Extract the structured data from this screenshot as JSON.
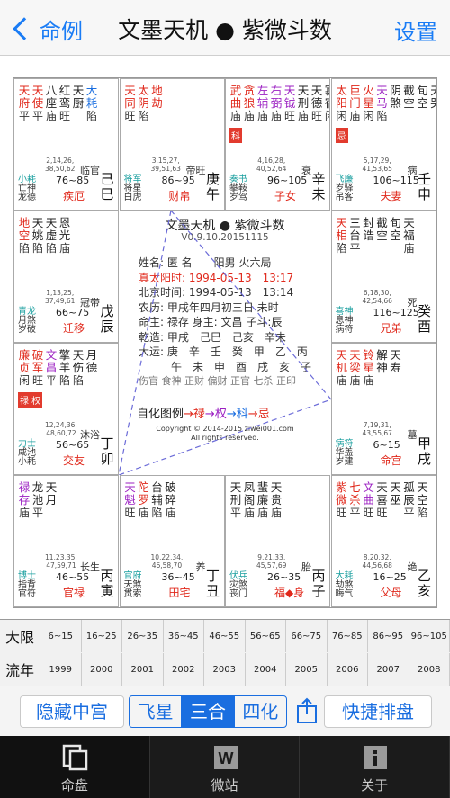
{
  "nav": {
    "back_label": "命例",
    "title": "文墨天机 ● 紫微斗数",
    "right_label": "设置"
  },
  "colors": {
    "accent": "#1a7cf5",
    "red": "#e0281b",
    "blue": "#1a6ee0",
    "purple": "#9b1fc2",
    "badge": "#e23b2e"
  },
  "cells": [
    {
      "id": "si",
      "stars": [
        [
          "天",
          "府",
          "平"
        ],
        [
          "天",
          "使",
          "平"
        ],
        [
          "八",
          "座",
          "庙"
        ],
        [
          "红",
          "鸾",
          "旺"
        ],
        [
          "天",
          "厨",
          "",
          ""
        ],
        [
          "大",
          "耗",
          "陷"
        ]
      ],
      "star_colors": [
        "red",
        "red",
        "dark",
        "dark",
        "dark",
        "blue"
      ],
      "hua": "",
      "nums": [
        "2,14,26,",
        "38,50,62"
      ],
      "changsheng": "临官",
      "bottom": [
        "小耗",
        "亡神",
        "龙德"
      ],
      "daxian": "76~85",
      "palace": "疾厄",
      "gz": [
        "己",
        "巳"
      ]
    },
    {
      "id": "wu",
      "stars": [
        [
          "天",
          "同",
          "旺"
        ],
        [
          "太",
          "阴",
          "陷"
        ],
        [
          "地",
          "劫",
          ""
        ]
      ],
      "star_colors": [
        "red",
        "red",
        "red"
      ],
      "hua": "",
      "nums": [
        "3,15,27,",
        "39,51,63"
      ],
      "changsheng": "帝旺",
      "bottom": [
        "将军",
        "将星",
        "白虎"
      ],
      "daxian": "86~95",
      "palace": "财帛",
      "gz": [
        "庚",
        "午"
      ]
    },
    {
      "id": "wei",
      "stars": [
        [
          "武",
          "曲",
          "庙"
        ],
        [
          "贪",
          "狼",
          "庙"
        ],
        [
          "左",
          "辅",
          "庙"
        ],
        [
          "右",
          "弼",
          "庙"
        ],
        [
          "天",
          "钺",
          "旺"
        ],
        [
          "天",
          "刑",
          "庙"
        ],
        [
          "天",
          "德",
          "旺"
        ],
        [
          "寡",
          "宿",
          "闲"
        ]
      ],
      "star_colors": [
        "red",
        "red",
        "purple",
        "purple",
        "purple",
        "dark",
        "dark",
        "dark"
      ],
      "hua": "科",
      "nums": [
        "4,16,28,",
        "40,52,64"
      ],
      "changsheng": "衰",
      "bottom": [
        "奏书",
        "攀鞍",
        "岁驾"
      ],
      "daxian": "96~105",
      "palace": "子女",
      "gz": [
        "辛",
        "未"
      ]
    },
    {
      "id": "shen",
      "stars": [
        [
          "太",
          "阳",
          "闲"
        ],
        [
          "巨",
          "门",
          "庙"
        ],
        [
          "火",
          "星",
          "闲"
        ],
        [
          "天",
          "马",
          "陷"
        ],
        [
          "阴",
          "煞",
          ""
        ],
        [
          "截",
          "空",
          ""
        ],
        [
          "旬",
          "空",
          ""
        ],
        [
          "天",
          "哭",
          ""
        ],
        [
          "天",
          "月",
          ""
        ]
      ],
      "star_colors": [
        "red",
        "red",
        "red",
        "purple",
        "dark",
        "dark",
        "dark",
        "dark",
        "dark"
      ],
      "hua": "忌",
      "nums": [
        "5,17,29,",
        "41,53,65"
      ],
      "changsheng": "病",
      "bottom": [
        "飞廉",
        "岁驿",
        "吊客"
      ],
      "daxian": "106~115",
      "palace": "夫妻",
      "gz": [
        "壬",
        "申"
      ]
    },
    {
      "id": "chen",
      "stars": [
        [
          "地",
          "空",
          "陷"
        ],
        [
          "天",
          "姚",
          "陷"
        ],
        [
          "天",
          "虚",
          "陷"
        ],
        [
          "恩",
          "光",
          "庙"
        ]
      ],
      "star_colors": [
        "red",
        "dark",
        "dark",
        "dark"
      ],
      "hua": "",
      "nums": [
        "1,13,25,",
        "37,49,61"
      ],
      "changsheng": "冠带",
      "bottom": [
        "青龙",
        "月煞",
        "岁破"
      ],
      "daxian": "66~75",
      "palace": "迁移",
      "gz": [
        "戊",
        "辰"
      ]
    },
    {
      "id": "you",
      "stars": [
        [
          "天",
          "相",
          "陷"
        ],
        [
          "三",
          "台",
          "平"
        ],
        [
          "封",
          "诰",
          ""
        ],
        [
          "截",
          "空",
          ""
        ],
        [
          "旬",
          "空",
          ""
        ],
        [
          "天",
          "福",
          "庙"
        ]
      ],
      "star_colors": [
        "red",
        "dark",
        "dark",
        "dark",
        "dark",
        "dark"
      ],
      "hua": "",
      "nums": [
        "6,18,30,",
        "42,54,66"
      ],
      "changsheng": "死",
      "bottom": [
        "喜神",
        "息神",
        "病符"
      ],
      "daxian": "116~125",
      "palace": "兄弟",
      "gz": [
        "癸",
        "酉"
      ]
    },
    {
      "id": "mao",
      "stars": [
        [
          "廉",
          "贞",
          "闲"
        ],
        [
          "破",
          "军",
          "旺"
        ],
        [
          "文",
          "昌",
          "平"
        ],
        [
          "擎",
          "羊",
          "陷"
        ],
        [
          "天",
          "伤",
          "陷"
        ],
        [
          "月",
          "德",
          ""
        ]
      ],
      "star_colors": [
        "red",
        "red",
        "purple",
        "dark",
        "dark",
        "dark"
      ],
      "hua": "禄 权",
      "nums": [
        "12,24,36,",
        "48,60,72"
      ],
      "changsheng": "沐浴",
      "bottom": [
        "力士",
        "咸池",
        "小耗"
      ],
      "daxian": "56~65",
      "palace": "交友",
      "gz": [
        "丁",
        "卯"
      ]
    },
    {
      "id": "xu",
      "stars": [
        [
          "天",
          "机",
          "庙"
        ],
        [
          "天",
          "梁",
          "庙"
        ],
        [
          "铃",
          "星",
          "庙"
        ],
        [
          "解",
          "神",
          ""
        ],
        [
          "天",
          "寿",
          ""
        ]
      ],
      "star_colors": [
        "red",
        "red",
        "red",
        "dark",
        "dark"
      ],
      "hua": "",
      "nums": [
        "7,19,31,",
        "43,55,67"
      ],
      "changsheng": "墓",
      "bottom": [
        "病符",
        "华盖",
        "岁建"
      ],
      "daxian": "6~15",
      "palace": "命宫",
      "gz": [
        "甲",
        "戌"
      ]
    },
    {
      "id": "yin",
      "stars": [
        [
          "禄",
          "存",
          "庙"
        ],
        [
          "龙",
          "池",
          "平"
        ],
        [
          "天",
          "月",
          ""
        ]
      ],
      "star_colors": [
        "purple",
        "dark",
        "dark"
      ],
      "hua": "",
      "nums": [
        "11,23,35,",
        "47,59,71"
      ],
      "changsheng": "长生",
      "bottom": [
        "博士",
        "指背",
        "官符"
      ],
      "daxian": "46~55",
      "palace": "官禄",
      "gz": [
        "丙",
        "寅"
      ]
    },
    {
      "id": "chou",
      "stars": [
        [
          "天",
          "魁",
          "旺"
        ],
        [
          "陀",
          "罗",
          "庙"
        ],
        [
          "台",
          "辅",
          "陷"
        ],
        [
          "破",
          "碎",
          "庙"
        ]
      ],
      "star_colors": [
        "purple",
        "red",
        "dark",
        "dark"
      ],
      "hua": "",
      "nums": [
        "10,22,34,",
        "46,58,70"
      ],
      "changsheng": "养",
      "bottom": [
        "官府",
        "天煞",
        "贯索"
      ],
      "daxian": "36~45",
      "palace": "田宅",
      "gz": [
        "丁",
        "丑"
      ]
    },
    {
      "id": "zi",
      "stars": [
        [
          "天",
          "刑",
          "平"
        ],
        [
          "凤",
          "阁",
          "庙"
        ],
        [
          "蜚",
          "廉",
          "庙"
        ],
        [
          "天",
          "贵",
          "庙"
        ]
      ],
      "star_colors": [
        "dark",
        "dark",
        "dark",
        "dark"
      ],
      "hua": "",
      "nums": [
        "9,21,33,",
        "45,57,69"
      ],
      "changsheng": "胎",
      "bottom": [
        "伏兵",
        "灾煞",
        "丧门"
      ],
      "daxian": "26~35",
      "palace": "福◆身",
      "gz": [
        "丙",
        "子"
      ]
    },
    {
      "id": "hai",
      "stars": [
        [
          "紫",
          "微",
          "旺"
        ],
        [
          "七",
          "杀",
          "平"
        ],
        [
          "文",
          "曲",
          "旺"
        ],
        [
          "天",
          "喜",
          "旺"
        ],
        [
          "天",
          "巫",
          ""
        ],
        [
          "孤",
          "辰",
          "平"
        ],
        [
          "天",
          "空",
          "陷"
        ]
      ],
      "star_colors": [
        "red",
        "red",
        "purple",
        "dark",
        "dark",
        "dark",
        "dark"
      ],
      "hua": "",
      "nums": [
        "8,20,32,",
        "44,56,68"
      ],
      "changsheng": "绝",
      "bottom": [
        "大耗",
        "劫煞",
        "晦气"
      ],
      "daxian": "16~25",
      "palace": "父母",
      "gz": [
        "乙",
        "亥"
      ]
    }
  ],
  "center": {
    "title": "文墨天机 ● 紫微斗数",
    "version": "V0.9.10.20151115",
    "lines": [
      {
        "text": "姓名: 匿 名　　阳男 火六局",
        "cls": ""
      },
      {
        "text": "真太阳时: 1994-05-13　13:17",
        "cls": "red"
      },
      {
        "text": "北京时间: 1994-05-13　13:14",
        "cls": ""
      },
      {
        "text": "农历: 甲戌年四月初三日 未时",
        "cls": ""
      },
      {
        "text": "命主: 禄存 身主: 文昌 子斗:辰",
        "cls": ""
      },
      {
        "text": "乾造: 甲戌　己巳　己亥　辛未",
        "cls": ""
      },
      {
        "text": "大运: 庚　辛　壬　癸　甲　乙　丙",
        "cls": ""
      },
      {
        "text": "　　　午　未　申　酉　戌　亥　子",
        "cls": ""
      },
      {
        "text": "伤官 食神 正财 偏财 正官 七杀 正印",
        "cls": "muted"
      }
    ],
    "legend": {
      "label": "自化图例",
      "lu": "→禄",
      "quan": "→权",
      "ke": "→科",
      "ji": "→忌"
    },
    "copyright": [
      "Copyright © 2014-2015 ziwei001.com",
      "All rights reserved."
    ]
  },
  "table": {
    "row1_label": "大限",
    "row1": [
      "6~15",
      "16~25",
      "26~35",
      "36~45",
      "46~55",
      "56~65",
      "66~75",
      "76~85",
      "86~95",
      "96~105"
    ],
    "row2_label": "流年",
    "row2": [
      "1999",
      "2000",
      "2001",
      "2002",
      "2003",
      "2004",
      "2005",
      "2006",
      "2007",
      "2008"
    ]
  },
  "modebar": {
    "hide_label": "隐藏中宫",
    "seg": [
      "飞星",
      "三合",
      "四化"
    ],
    "seg_active": 1,
    "quick_label": "快捷排盘"
  },
  "tabbar": {
    "tabs": [
      {
        "label": "命盘",
        "icon": "pages-icon"
      },
      {
        "label": "微站",
        "icon": "w-icon"
      },
      {
        "label": "关于",
        "icon": "info-icon"
      }
    ],
    "active": 0
  }
}
